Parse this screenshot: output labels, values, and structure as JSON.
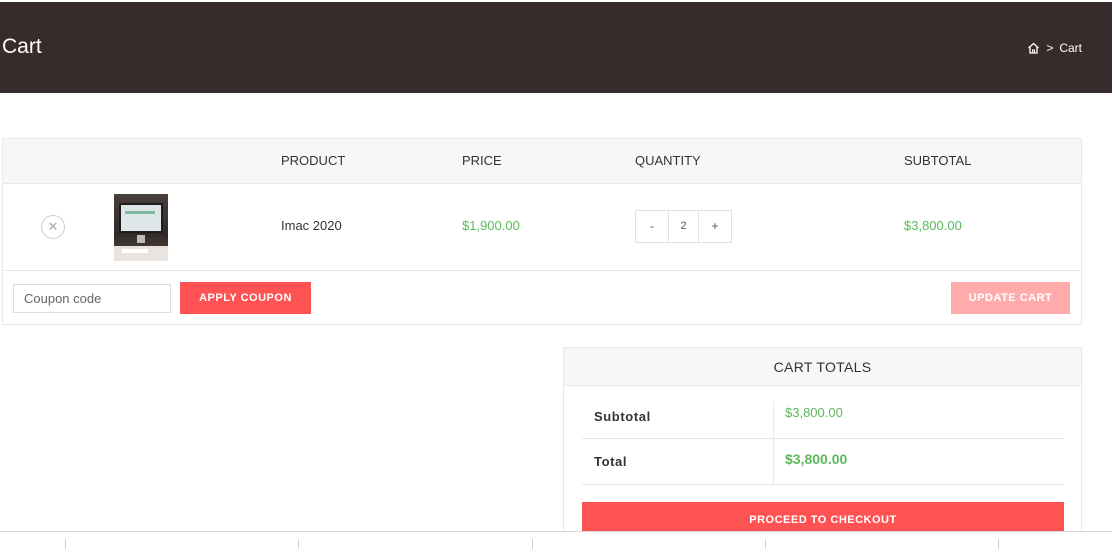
{
  "header": {
    "title": "Cart",
    "breadcrumb": {
      "home_icon": "home-icon",
      "separator": ">",
      "current": "Cart"
    },
    "background": "#372c2b"
  },
  "cart_table": {
    "columns": [
      "PRODUCT",
      "PRICE",
      "QUANTITY",
      "SUBTOTAL"
    ],
    "items": [
      {
        "remove_icon": "close-icon",
        "name": "Imac 2020",
        "price": "$1,900.00",
        "quantity": "2",
        "minus": "-",
        "plus": "+",
        "subtotal": "$3,800.00"
      }
    ],
    "coupon_placeholder": "Coupon code",
    "apply_coupon_label": "APPLY COUPON",
    "update_cart_label": "UPDATE CART"
  },
  "cart_totals": {
    "title": "CART TOTALS",
    "subtotal_label": "Subtotal",
    "subtotal_value": "$3,800.00",
    "total_label": "Total",
    "total_value": "$3,800.00",
    "checkout_label": "PROCEED TO CHECKOUT"
  },
  "colors": {
    "accent": "#ff5353",
    "accent_disabled": "#ffabab",
    "price_green": "#5cb85c"
  }
}
